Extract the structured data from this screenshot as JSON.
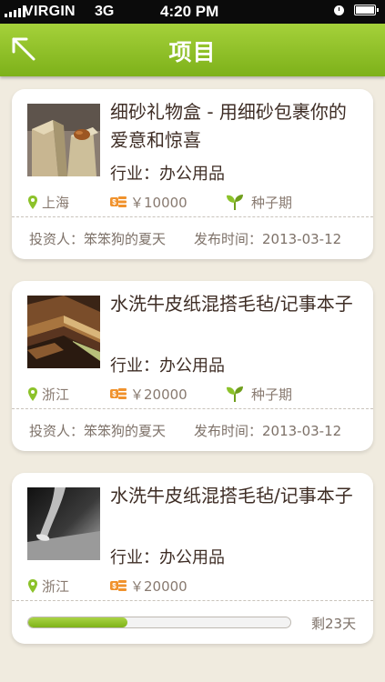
{
  "status_bar": {
    "carrier": "VIRGIN",
    "network": "3G",
    "time": "4:20 PM"
  },
  "nav": {
    "title": "项目",
    "back_icon": "back-arrow-icon"
  },
  "colors": {
    "accent": "#8cc22a",
    "text_dark": "#3e2d25",
    "text_muted": "#887a70",
    "background": "#f0ebdf"
  },
  "projects": [
    {
      "title": "细砂礼物盒 - 用细砂包裹你的爱意和惊喜",
      "industry": "行业：办公用品",
      "location": "上海",
      "amount": "￥10000",
      "stage": "种子期",
      "investor": "投资人：笨笨狗的夏天",
      "publish_time": "发布时间：2013-03-12"
    },
    {
      "title": "水洗牛皮纸混搭毛毡/记事本子",
      "industry": "行业：办公用品",
      "location": "浙江",
      "amount": "￥20000",
      "stage": "种子期",
      "investor": "投资人：笨笨狗的夏天",
      "publish_time": "发布时间：2013-03-12"
    },
    {
      "title": "水洗牛皮纸混搭毛毡/记事本子",
      "industry": "行业：办公用品",
      "location": "浙江",
      "amount": "￥20000",
      "progress": 0.38,
      "remaining": "剩23天"
    }
  ]
}
